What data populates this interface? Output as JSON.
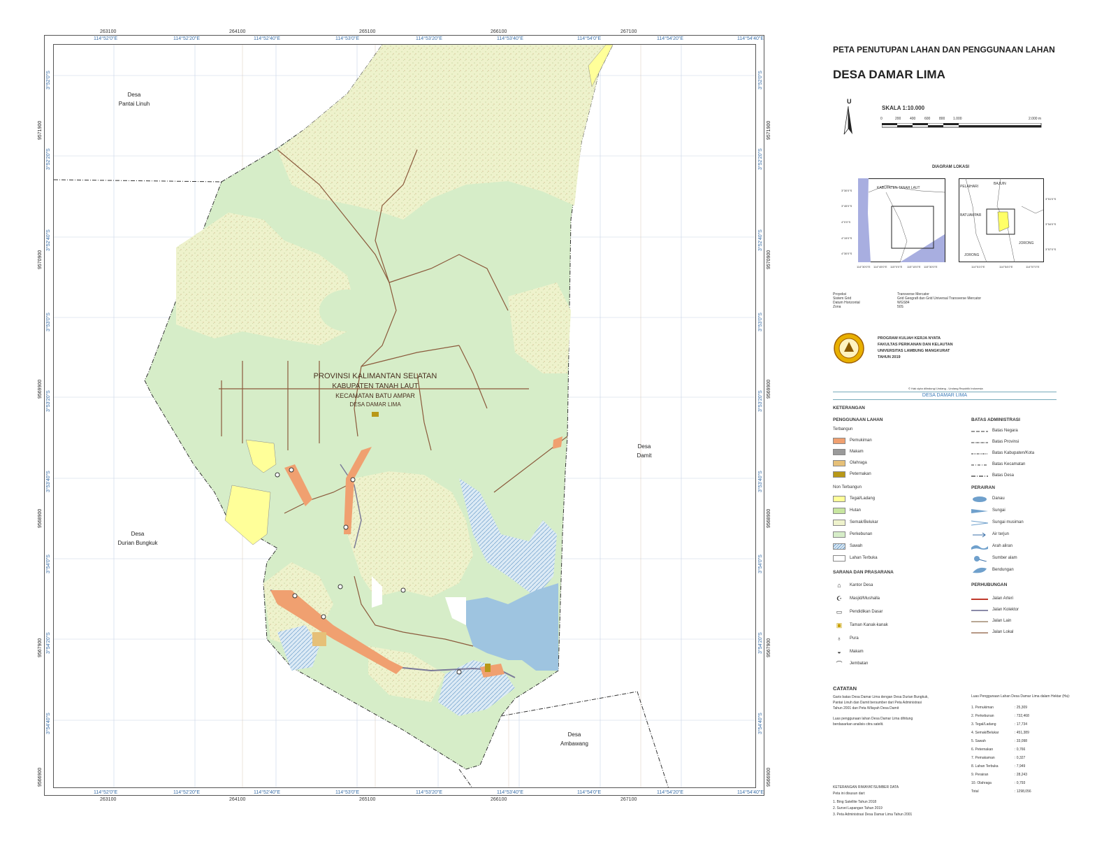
{
  "map": {
    "top_utm": [
      "263100",
      "264100",
      "265100",
      "266100",
      "267100"
    ],
    "bottom_utm": [
      "263100",
      "264100",
      "265100",
      "266100",
      "267100"
    ],
    "top_lon": [
      "114°52'0\"E",
      "114°52'20\"E",
      "114°52'40\"E",
      "114°53'0\"E",
      "114°53'20\"E",
      "114°53'40\"E",
      "114°54'0\"E",
      "114°54'20\"E",
      "114°54'40\"E"
    ],
    "bottom_lon": [
      "114°52'0\"E",
      "114°52'20\"E",
      "114°52'40\"E",
      "114°53'0\"E",
      "114°53'20\"E",
      "114°53'40\"E",
      "114°54'0\"E",
      "114°54'20\"E",
      "114°54'40\"E"
    ],
    "left_lat": [
      "3°52'0\"S",
      "3°52'20\"S",
      "3°52'40\"S",
      "3°53'0\"S",
      "3°53'20\"S",
      "3°53'40\"S",
      "3°54'0\"S",
      "3°54'20\"S",
      "3°54'40\"S"
    ],
    "right_lat": [
      "3°52'0\"S",
      "3°52'20\"S",
      "3°52'40\"S",
      "3°53'0\"S",
      "3°53'20\"S",
      "3°53'40\"S",
      "3°54'0\"S",
      "3°54'20\"S",
      "3°54'40\"S"
    ],
    "left_utm": [
      "9571900",
      "9570900",
      "9569900",
      "9568900",
      "9567900",
      "9566900"
    ],
    "right_utm": [
      "9571900",
      "9570900",
      "9569900",
      "9568900",
      "9567900",
      "9566900"
    ],
    "villages": {
      "pantai_linuh": [
        "Desa",
        "Pantai Linuh"
      ],
      "damit": [
        "Desa",
        "Damit"
      ],
      "durian_bungkuk": [
        "Desa",
        "Durian Bungkuk"
      ],
      "ambawang": [
        "Desa",
        "Ambawang"
      ]
    },
    "admin": {
      "provinsi": "PROVINSI KALIMANTAN SELATAN",
      "kabupaten": "KABUPATEN TANAH LAUT",
      "kecamatan": "KECAMATAN BATU AMPAR",
      "desa": "DESA DAMAR LIMA"
    }
  },
  "panel": {
    "title_main": "PETA PENUTUPAN LAHAN DAN PENGGUNAAN LAHAN",
    "title_desa": "DESA DAMAR LIMA",
    "north": "U",
    "scale_label": "SKALA 1:10.000",
    "scale_ticks": [
      "0",
      "200",
      "400",
      "600",
      "800",
      "1.000",
      "2.000 m"
    ],
    "diagram_title": "DIAGRAM LOKASI",
    "inset1": {
      "label": "KABUPATEN TANAH LAUT",
      "lat": [
        "3°30'0\"S",
        "3°45'0\"S",
        "4°0'0\"S",
        "4°15'0\"S",
        "4°30'0\"S"
      ],
      "lon": [
        "114°30'0\"E",
        "114°45'0\"E",
        "115°0'0\"E",
        "115°15'0\"E",
        "115°30'0\"E"
      ]
    },
    "inset2": {
      "labels": [
        "BAJUIN",
        "PELAIHARI",
        "BATUAMPAR",
        "JORONG",
        "JORONG"
      ],
      "lat": [
        "3°51'0\"S",
        "3°54'0\"S",
        "3°57'0\"S"
      ],
      "lon": [
        "114°51'0\"E",
        "114°54'0\"E",
        "114°57'0\"E"
      ]
    },
    "projection": [
      {
        "k": "Proyeksi",
        "v": "Transverse Mercator"
      },
      {
        "k": "Sistem Grid",
        "v": "Grid Geografi dan Grid Universal Transverse Mercator"
      },
      {
        "k": "Datum Horizontal",
        "v": "WGS84"
      },
      {
        "k": "Zona",
        "v": "50S"
      }
    ],
    "institution": [
      "PROGRAM KULIAH KERJA NYATA",
      "FAKULTAS PERIKANAN DAN KELAUTAN",
      "UNIVERSITAS LAMBUNG MANGKURAT",
      "TAHUN 2019"
    ],
    "copyright": "© Hak cipta dilindungi Undang - Undang Republik Indonesia",
    "legend_banner": "DESA DAMAR LIMA",
    "keterangan": "KETERANGAN",
    "penggunaan_lahan": "PENGGUNAAN LAHAN",
    "terbangun": "Terbangun",
    "terbangun_items": [
      {
        "label": "Pemukiman",
        "color": "#f0a070"
      },
      {
        "label": "Makam",
        "color": "#9a9a9a"
      },
      {
        "label": "Olahraga",
        "color": "#e6c078"
      },
      {
        "label": "Peternakan",
        "color": "#b89818"
      }
    ],
    "non_terbangun": "Non Terbangun",
    "non_terbangun_items": [
      {
        "label": "Tegal/Ladang",
        "color": "#ffff99"
      },
      {
        "label": "Hutan",
        "color": "#c8e6a0"
      },
      {
        "label": "Semak/Belukar",
        "color": "#eef2cc"
      },
      {
        "label": "Perkebunan",
        "color": "#d6edc8"
      },
      {
        "label": "Sawah",
        "color": "#cfe3f2"
      },
      {
        "label": "Lahan Terbuka",
        "color": "#ffffff"
      }
    ],
    "sarana": "SARANA DAN PRASARANA",
    "sarana_items": [
      {
        "label": "Kantor Desa",
        "icon": "building-icon"
      },
      {
        "label": "Masjid/Mushalla",
        "icon": "mosque-icon"
      },
      {
        "label": "Pendidikan Dasar",
        "icon": "book-icon"
      },
      {
        "label": "Taman Kanak-kanak",
        "icon": "kindergarten-icon"
      },
      {
        "label": "Pura",
        "icon": "temple-icon"
      },
      {
        "label": "Makam",
        "icon": "grave-icon"
      },
      {
        "label": "Jembatan",
        "icon": "bridge-icon"
      }
    ],
    "batas": "BATAS ADMINISTRASI",
    "batas_items": [
      "Batas Negara",
      "Batas Provinsi",
      "Batas Kabupaten/Kota",
      "Batas Kecamatan",
      "Batas Desa"
    ],
    "perairan": "PERAIRAN",
    "perairan_items": [
      "Danau",
      "Sungai",
      "Sungai musiman",
      "Air terjun",
      "Arah aliran",
      "Sumber alam",
      "Bendungan"
    ],
    "perhubungan": "PERHUBUNGAN",
    "perhubungan_items": [
      {
        "label": "Jalan Arteri",
        "color": "#c0392b"
      },
      {
        "label": "Jalan Kolektor",
        "color": "#8a8aa8"
      },
      {
        "label": "Jalan Lain",
        "color": "#a08a70"
      },
      {
        "label": "Jalan Lokal",
        "color": "#8b5a3c"
      }
    ],
    "catatan": "CATATAN",
    "catatan_text1": [
      "Garis batas Desa Damar Lima dengan Desa Durian Bungkuk,",
      "Pantai Linuh dan Damit bersumber dari Peta Administrasi",
      "Tahun 2001 dan Peta Wilayah Desa Damit"
    ],
    "catatan_text2": [
      "Luas penggunaan lahan Desa Damar Lima dihitung",
      "berdasarkan analisis citra satelit."
    ],
    "luas_title": "Luas Penggunaan Lahan Desa Damar Lima dalam Hektar (Ha):",
    "luas_items": [
      {
        "k": "1. Pemukiman",
        "v": ": 25,309"
      },
      {
        "k": "2. Perkebunan",
        "v": ": 732,468"
      },
      {
        "k": "3. Tegal/Ladang",
        "v": ": 17,734"
      },
      {
        "k": "4. Semak/Belukar",
        "v": ": 451,389"
      },
      {
        "k": "5. Sawah",
        "v": ": 33,098"
      },
      {
        "k": "6. Peternakan",
        "v": ": 0,766"
      },
      {
        "k": "7. Pemakaman",
        "v": ": 0,327"
      },
      {
        "k": "8. Lahan Terbuka",
        "v": ": 7,949"
      },
      {
        "k": "9. Perairan",
        "v": ": 28,243"
      },
      {
        "k": "10. Olahraga",
        "v": ": 0,793"
      },
      {
        "k": "Total",
        "v": ": 1298,056"
      }
    ],
    "riwayat_title": "KETERANGAN RIWAYAT/SUMBER DATA",
    "riwayat_intro": "Peta ini disusun dari:",
    "riwayat_items": [
      "1. Bing Satellite Tahun 2018",
      "2. Survei Lapangan Tahun 2019",
      "3. Peta Administrasi Desa Damar Lima Tahun 2001"
    ]
  }
}
